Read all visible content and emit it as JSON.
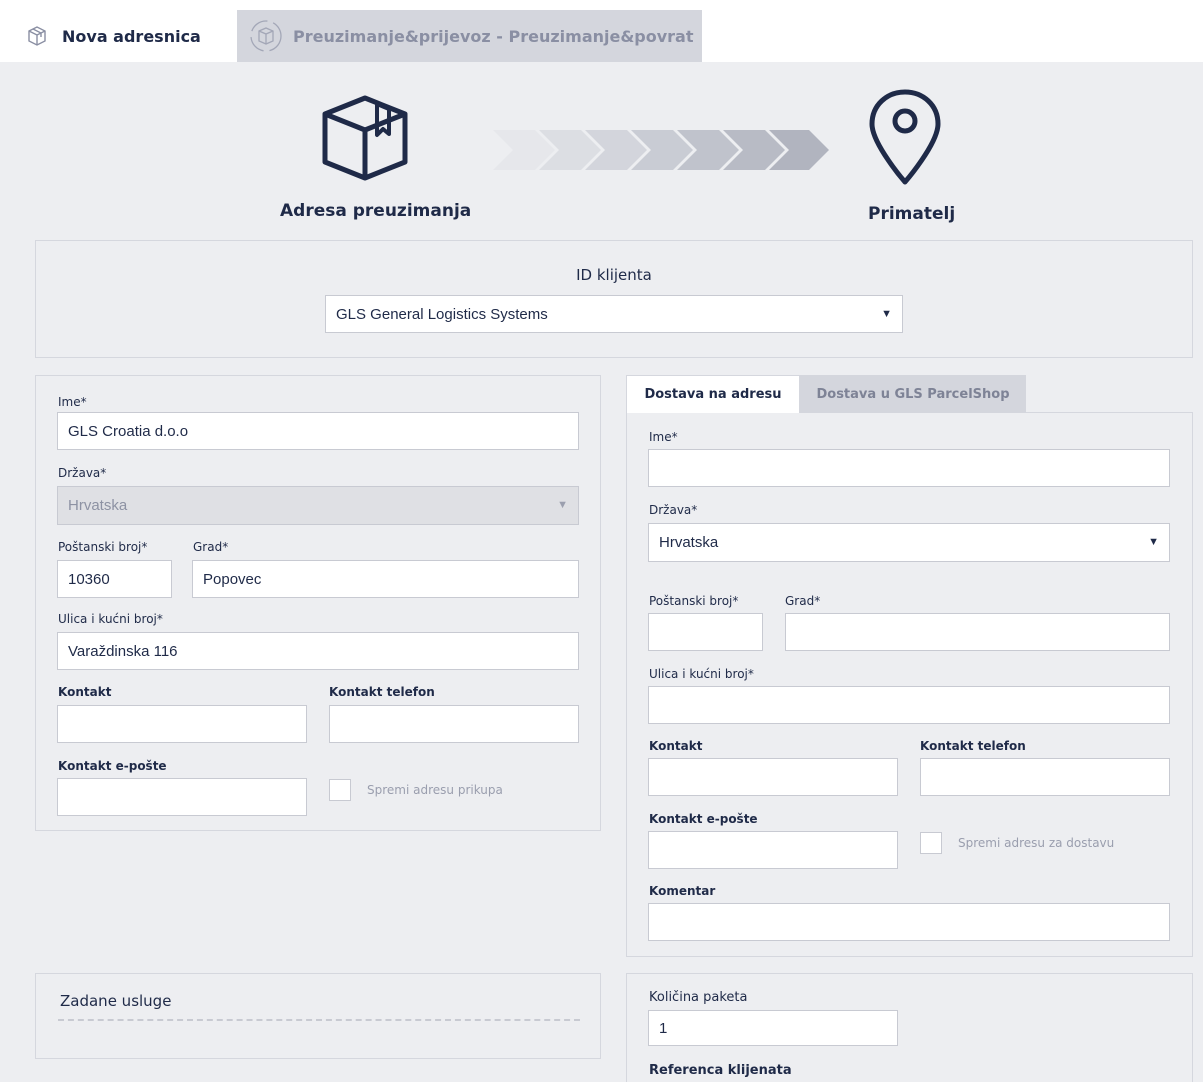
{
  "tabs": [
    {
      "label": "Nova adresnica",
      "icon": "package-icon",
      "active": true
    },
    {
      "label": "Preuzimanje&prijevoz - Preuzimanje&povrat",
      "icon": "package-cycle-icon",
      "active": false
    }
  ],
  "hero": {
    "pickup_label": "Adresa preuzimanja",
    "recipient_label": "Primatelj"
  },
  "client": {
    "label": "ID klijenta",
    "value": "GLS General Logistics Systems"
  },
  "pickup": {
    "name_label": "Ime*",
    "name_value": "GLS Croatia d.o.o",
    "country_label": "Država*",
    "country_value": "Hrvatska",
    "zip_label": "Poštanski broj*",
    "zip_value": "10360",
    "city_label": "Grad*",
    "city_value": "Popovec",
    "street_label": "Ulica i kućni broj*",
    "street_value": "Varaždinska 116",
    "contact_label": "Kontakt",
    "phone_label": "Kontakt telefon",
    "email_label": "Kontakt e-pošte",
    "save_label": "Spremi adresu prikupa"
  },
  "recipient": {
    "tabs": [
      "Dostava na adresu",
      "Dostava u GLS ParcelShop"
    ],
    "name_label": "Ime*",
    "country_label": "Država*",
    "country_value": "Hrvatska",
    "zip_label": "Poštanski broj*",
    "city_label": "Grad*",
    "street_label": "Ulica i kućni broj*",
    "contact_label": "Kontakt",
    "phone_label": "Kontakt telefon",
    "email_label": "Kontakt e-pošte",
    "save_label": "Spremi adresu za dostavu",
    "comment_label": "Komentar"
  },
  "services": {
    "title": "Zadane usluge"
  },
  "parcels": {
    "qty_label": "Količina paketa",
    "qty_value": "1",
    "ref_label": "Referenca klijenata"
  }
}
